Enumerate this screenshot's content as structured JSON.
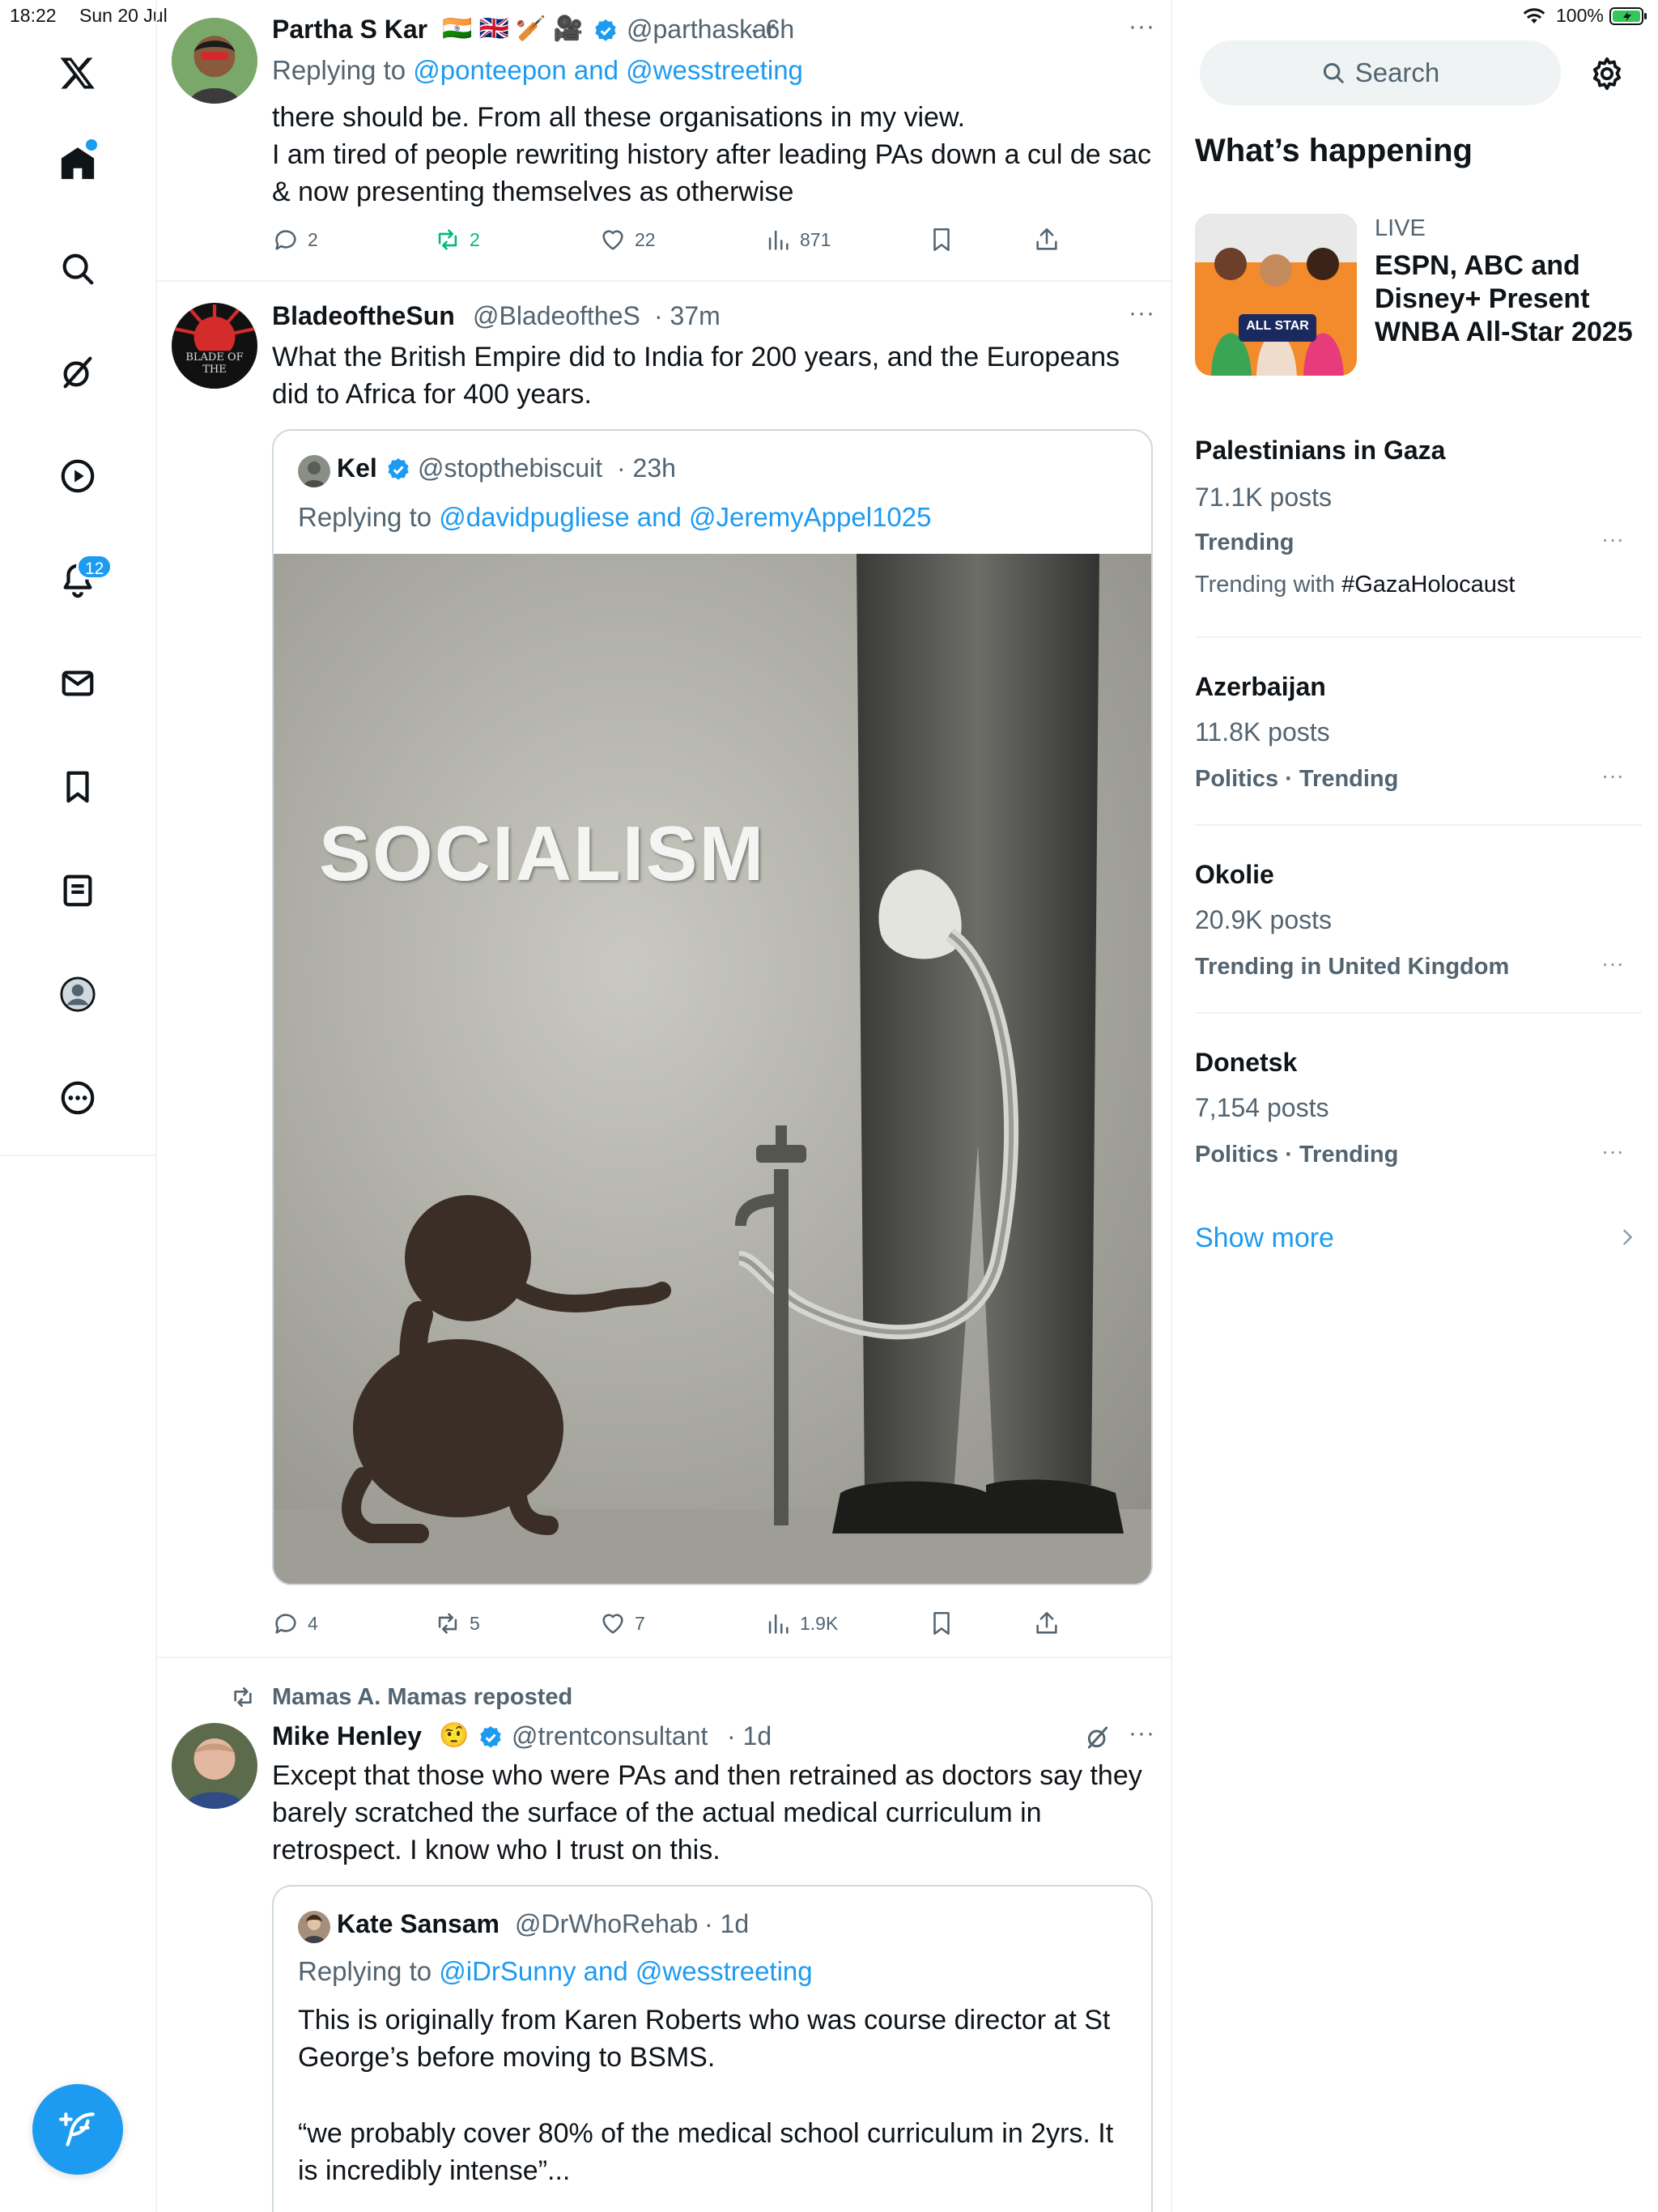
{
  "status_bar": {
    "time": "18:22",
    "date": "Sun 20 Jul",
    "battery": "100%"
  },
  "nav": {
    "notifications_count": "12"
  },
  "posts": [
    {
      "author": "Partha S Kar",
      "author_flags": "🇮🇳 🇬🇧 🏏 🎥",
      "handle": "@parthaskar",
      "time": "· 6h",
      "reply_prefix": "Replying to ",
      "reply_to": "@ponteepon and @wesstreeting",
      "text_1": "there should be. From all these organisations in my view.",
      "text_2": "I am tired of people rewriting history after leading PAs down a cul de sac & now presenting themselves as otherwise",
      "replies": "2",
      "reposts": "2",
      "likes": "22",
      "views": "871"
    },
    {
      "author": "BladeoftheSun",
      "handle": "@BladeoftheS",
      "time": "· 37m",
      "text": "What the British Empire did to India for 200 years, and the Europeans did to Africa for 400 years.",
      "avatar_text": "BLADE OF THE",
      "quote": {
        "author": "Kel",
        "handle": "@stopthebiscuit",
        "time": "· 23h",
        "reply_prefix": "Replying to ",
        "reply_to": "@davidpugliese and @JeremyAppel1025",
        "image_caption": "SOCIALISM"
      },
      "replies": "4",
      "reposts": "5",
      "likes": "7",
      "views": "1.9K"
    },
    {
      "repost_label": "Mamas A. Mamas reposted",
      "author": "Mike Henley",
      "author_emoji": "🤨",
      "handle": "@trentconsultant",
      "time": "· 1d",
      "text": "Except that those who were PAs and then retrained as doctors say they barely scratched the surface of the actual medical curriculum in retrospect. I know who I trust on this.",
      "quote": {
        "author": "Kate Sansam",
        "handle": "@DrWhoRehab",
        "time": "· 1d",
        "reply_prefix": "Replying to ",
        "reply_to": "@iDrSunny and @wesstreeting",
        "text_1": "This is originally from Karen Roberts who was course director at St George’s before moving to  BSMS.",
        "text_2": "“we probably cover 80% of the medical school curriculum in 2yrs. It is incredibly intense”..."
      }
    }
  ],
  "sidebar_right": {
    "search_placeholder": "Search",
    "heading": "What’s happening",
    "live": {
      "label": "LIVE",
      "title": "ESPN, ABC and Disney+ Present WNBA All-Star 2025",
      "image_text": "ALL STAR"
    },
    "trends": [
      {
        "title": "Palestinians in Gaza",
        "posts": "71.1K posts",
        "meta": "Trending",
        "with_prefix": "Trending with ",
        "with_tag": "#GazaHolocaust"
      },
      {
        "title": "Azerbaijan",
        "posts": "11.8K posts",
        "meta": "Politics · Trending"
      },
      {
        "title": "Okolie",
        "posts": "20.9K posts",
        "meta": "Trending in United Kingdom"
      },
      {
        "title": "Donetsk",
        "posts": "7,154 posts",
        "meta": "Politics · Trending"
      }
    ],
    "show_more": "Show more"
  },
  "colors": {
    "accent": "#1d9bf0",
    "repost_green": "#00ba7c",
    "text_primary": "#0f1419",
    "text_secondary": "#536471"
  }
}
